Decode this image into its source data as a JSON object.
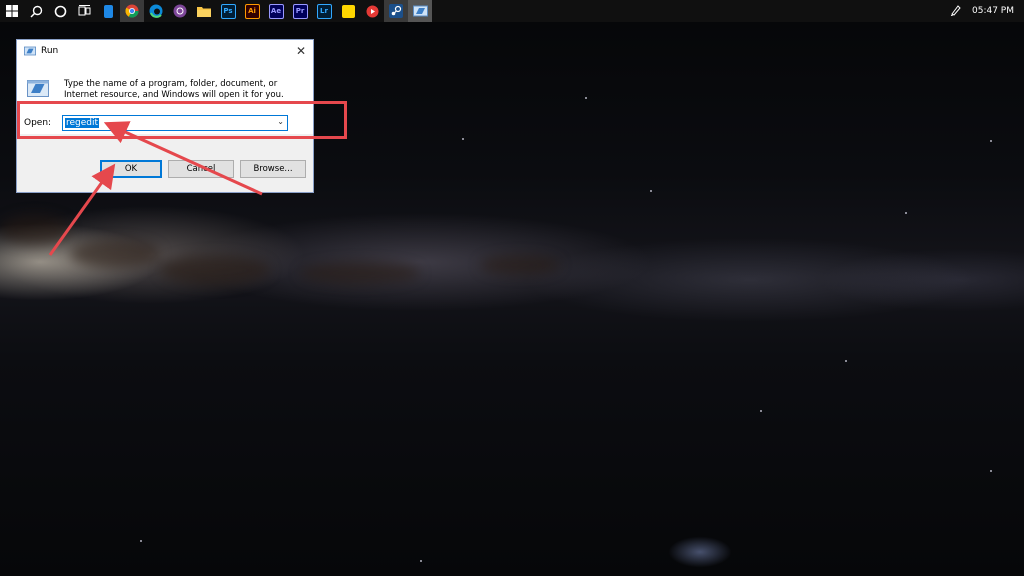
{
  "taskbar": {
    "items": [
      {
        "icon": "windows-start-icon"
      },
      {
        "icon": "search-icon"
      },
      {
        "icon": "cortana-icon"
      },
      {
        "icon": "task-view-icon"
      },
      {
        "icon": "file-icon"
      },
      {
        "icon": "chrome-icon"
      },
      {
        "icon": "edge-icon"
      },
      {
        "icon": "tor-browser-icon"
      },
      {
        "icon": "file-explorer-icon"
      },
      {
        "label": "Ps",
        "icon": "photoshop-icon",
        "color": "#31a8ff",
        "bg": "#001e36"
      },
      {
        "label": "Ai",
        "icon": "illustrator-icon",
        "color": "#ff9a00",
        "bg": "#330000"
      },
      {
        "label": "Ae",
        "icon": "after-effects-icon",
        "color": "#9999ff",
        "bg": "#00005b"
      },
      {
        "label": "Pr",
        "icon": "premiere-icon",
        "color": "#9999ff",
        "bg": "#00005b"
      },
      {
        "label": "Lr",
        "icon": "lightroom-icon",
        "color": "#31a8ff",
        "bg": "#001e36"
      },
      {
        "icon": "sticky-notes-icon"
      },
      {
        "icon": "youtube-icon"
      },
      {
        "icon": "steam-icon"
      },
      {
        "icon": "run-icon"
      }
    ],
    "tray_icon": "pen-icon",
    "clock": "05:47 PM"
  },
  "run_dialog": {
    "title": "Run",
    "description": "Type the name of a program, folder, document, or Internet resource, and Windows will open it for you.",
    "open_label": "Open:",
    "open_value": "regedit",
    "buttons": {
      "ok": "OK",
      "cancel": "Cancel",
      "browse": "Browse..."
    }
  },
  "colors": {
    "annotation": "#e5484d",
    "accent": "#0078d7"
  }
}
